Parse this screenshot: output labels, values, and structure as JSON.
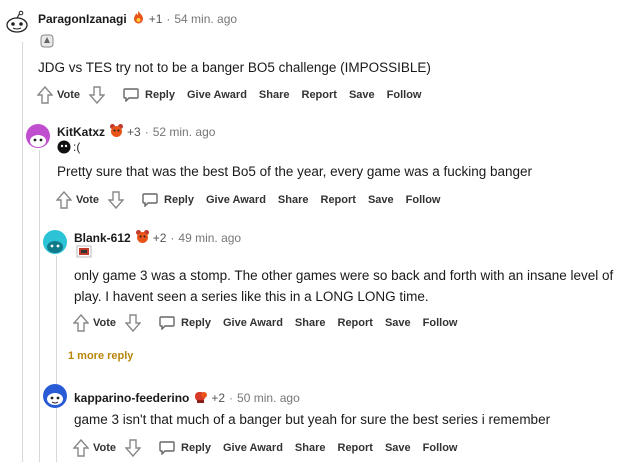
{
  "comments": [
    {
      "username": "ParagonIzanagi",
      "karma": "+1",
      "time": "54 min. ago",
      "flair_text": "",
      "body": "JDG vs TES try not to be a banger BO5 challenge (IMPOSSIBLE)"
    },
    {
      "username": "KitKatxz",
      "karma": "+3",
      "time": "52 min. ago",
      "flair_text": ":(",
      "body": "Pretty sure that was the best Bo5 of the year, every game was a fucking banger"
    },
    {
      "username": "Blank-612",
      "karma": "+2",
      "time": "49 min. ago",
      "flair_text": "",
      "body_lines": [
        "only game 3 was a stomp. The other games were so back and forth with an insane level of",
        "play. I havent seen a series like this in a LONG LONG time."
      ]
    },
    {
      "username": "kapparino-feederino",
      "karma": "+2",
      "time": "50 min. ago",
      "flair_text": "",
      "body": "game 3 isn't that much of a banger but yeah for sure the best series i remember"
    }
  ],
  "actions": {
    "vote": "Vote",
    "reply": "Reply",
    "give_award": "Give Award",
    "share": "Share",
    "report": "Report",
    "save": "Save",
    "follow": "Follow"
  },
  "separator": "·",
  "more_replies": "1 more reply",
  "colors": {
    "award_fire": "#e8541a",
    "more_reply": "#b8860b",
    "thread_line": "#d8d8d8"
  }
}
